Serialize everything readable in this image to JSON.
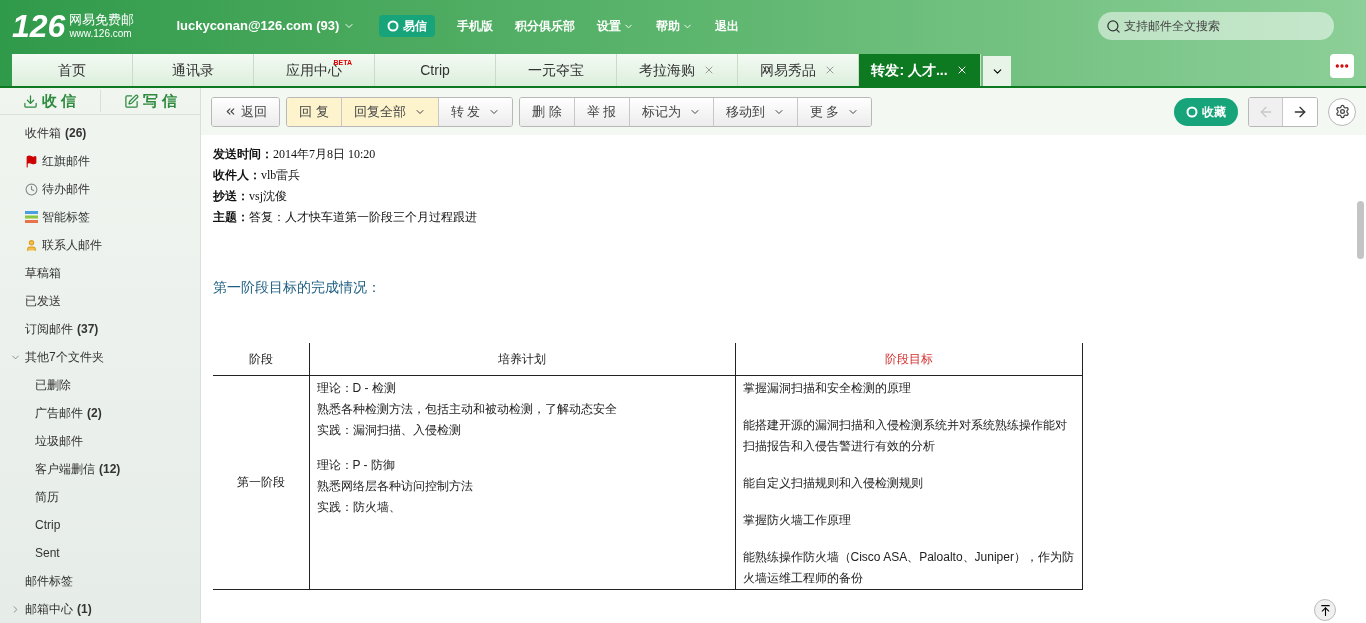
{
  "header": {
    "logo_number": "126",
    "logo_name": "网易免费邮",
    "logo_url": "www.126.com",
    "account": "luckyconan@126.com (93)",
    "links": [
      {
        "label": "易信",
        "kind": "yixin"
      },
      {
        "label": "手机版",
        "kind": "link"
      },
      {
        "label": "积分俱乐部",
        "kind": "link"
      },
      {
        "label": "设置",
        "kind": "dropdown"
      },
      {
        "label": "帮助",
        "kind": "dropdown"
      },
      {
        "label": "退出",
        "kind": "link"
      }
    ],
    "search": {
      "placeholder": "支持邮件全文搜索"
    }
  },
  "tabs": [
    {
      "label": "首页",
      "selected": false,
      "closable": false
    },
    {
      "label": "通讯录",
      "selected": false,
      "closable": false
    },
    {
      "label": "应用中心",
      "selected": false,
      "closable": false,
      "badge": "BETA"
    },
    {
      "label": "Ctrip",
      "selected": false,
      "closable": false
    },
    {
      "label": "一元夺宝",
      "selected": false,
      "closable": false
    },
    {
      "label": "考拉海购",
      "selected": false,
      "closable": true
    },
    {
      "label": "网易秀品",
      "selected": false,
      "closable": true
    },
    {
      "label": "转发: 人才...",
      "selected": true,
      "closable": true
    }
  ],
  "actions": {
    "receive": "收 信",
    "compose": "写 信"
  },
  "toolbar": [
    [
      {
        "label": "返回",
        "kind": "back"
      }
    ],
    [
      {
        "label": "回 复",
        "kind": "highlight"
      },
      {
        "label": "回复全部",
        "kind": "highlight-dropdown"
      },
      {
        "label": "转 发",
        "kind": "dropdown"
      }
    ],
    [
      {
        "label": "删 除",
        "kind": "plain"
      },
      {
        "label": "举 报",
        "kind": "plain"
      },
      {
        "label": "标记为",
        "kind": "dropdown"
      },
      {
        "label": "移动到",
        "kind": "dropdown"
      },
      {
        "label": "更 多",
        "kind": "dropdown"
      }
    ]
  ],
  "collect": "收藏",
  "nav": {
    "prev_disabled": true,
    "next_disabled": false
  },
  "folders": [
    {
      "label": "收件箱",
      "count": "(26)",
      "kind": "plain"
    },
    {
      "label": "红旗邮件",
      "kind": "flagged"
    },
    {
      "label": "待办邮件",
      "kind": "todo"
    },
    {
      "label": "智能标签",
      "kind": "tags"
    },
    {
      "label": "联系人邮件",
      "kind": "contacts"
    },
    {
      "label": "草稿箱",
      "kind": "plain"
    },
    {
      "label": "已发送",
      "kind": "plain"
    },
    {
      "label": "订阅邮件",
      "count": "(37)",
      "kind": "plain"
    },
    {
      "label": "其他7个文件夹",
      "kind": "plain",
      "expanded": true,
      "children": [
        {
          "label": "已删除"
        },
        {
          "label": "广告邮件",
          "count": "(2)"
        },
        {
          "label": "垃圾邮件"
        },
        {
          "label": "客户端删信",
          "count": "(12)"
        },
        {
          "label": "简历"
        },
        {
          "label": "Ctrip"
        },
        {
          "label": "Sent"
        }
      ]
    },
    {
      "label": "邮件标签",
      "kind": "plain"
    },
    {
      "label": "邮箱中心",
      "count": "(1)",
      "kind": "plain",
      "expanded": false
    }
  ],
  "mail_headers": [
    {
      "label": "发送时间：",
      "value": "2014年7月8日 10:20"
    },
    {
      "label": "收件人：",
      "value": "vlb雷兵"
    },
    {
      "label": "抄送：",
      "value": "vsj沈俊"
    },
    {
      "label": "主题：",
      "value": "答复：人才快车道第一阶段三个月过程跟进"
    }
  ],
  "section_heading": "第一阶段目标的完成情况：",
  "table": {
    "columns": [
      {
        "label": "阶段",
        "kind": "normal"
      },
      {
        "label": "培养计划",
        "kind": "normal"
      },
      {
        "label": "阶段目标",
        "kind": "highlight"
      }
    ],
    "rows": [
      {
        "stage": "第一阶段",
        "plan": [
          [
            "理论：D - 检测",
            "熟悉各种检测方法，包括主动和被动检测，了解动态安全",
            "实践：漏洞扫描、入侵检测"
          ],
          [
            "理论：P - 防御",
            "熟悉网络层各种访问控制方法",
            "实践：防火墙、"
          ]
        ],
        "goals": [
          "掌握漏洞扫描和安全检测的原理",
          "能搭建开源的漏洞扫描和入侵检测系统并对系统熟练操作能对扫描报告和入侵告警进行有效的分析",
          "能自定义扫描规则和入侵检测规则",
          "掌握防火墙工作原理",
          "能熟练操作防火墙（Cisco ASA、Paloalto、Juniper），作为防火墙运维工程师的备份"
        ]
      }
    ]
  }
}
